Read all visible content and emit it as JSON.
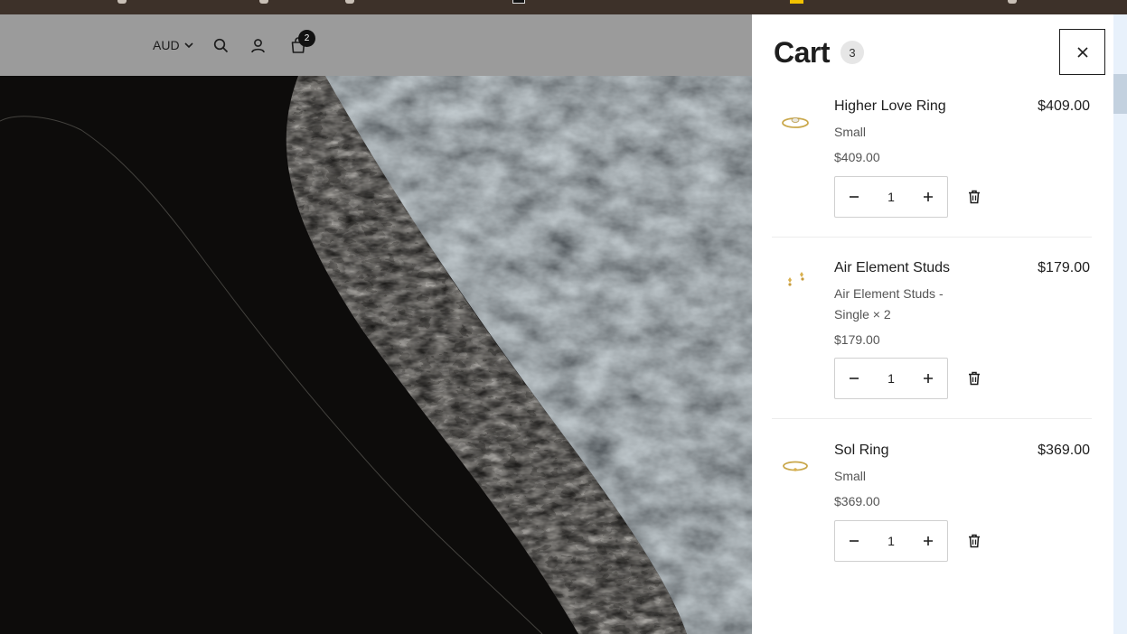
{
  "header": {
    "currency": "AUD",
    "cart_badge": "2",
    "icons": [
      "chevron-down-icon",
      "search-icon",
      "account-icon",
      "bag-icon"
    ]
  },
  "cart": {
    "title": "Cart",
    "count": "3",
    "items": [
      {
        "name": "Higher Love Ring",
        "price": "$409.00",
        "variant": "Small",
        "unit_price": "$409.00",
        "quantity": "1"
      },
      {
        "name": "Air Element Studs",
        "price": "$179.00",
        "variant": "Air Element Studs - Single × 2",
        "unit_price": "$179.00",
        "quantity": "1"
      },
      {
        "name": "Sol Ring",
        "price": "$369.00",
        "variant": "Small",
        "unit_price": "$369.00",
        "quantity": "1"
      }
    ]
  },
  "colors": {
    "browser_strip": "#3d3129",
    "header_overlay": "#9b9b9b",
    "text": "#1e1e1e",
    "badge": "#111111",
    "gold": "#c9a74a"
  }
}
